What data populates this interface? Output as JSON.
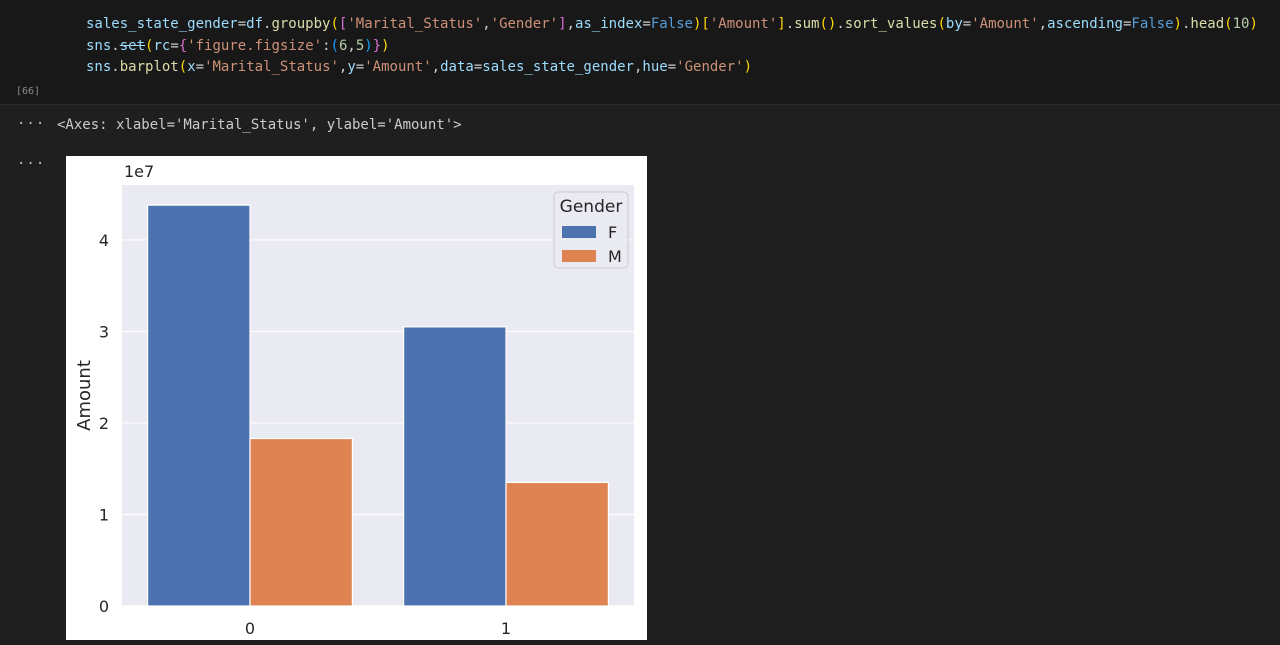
{
  "cell": {
    "execution_count": "[66]",
    "code_lines": [
      "sales_state_gender=df.groupby(['Marital_Status','Gender'],as_index=False)['Amount'].sum().sort_values(by='Amount',ascending=False).head(10)",
      "sns.set(rc={'figure.figsize':(6,5)})",
      "sns.barplot(x='Marital_Status',y='Amount',data=sales_state_gender,hue='Gender')"
    ]
  },
  "output": {
    "dots": "···",
    "text": "<Axes: xlabel='Marital_Status', ylabel='Amount'>"
  },
  "chart_data": {
    "type": "bar",
    "categories": [
      "0",
      "1"
    ],
    "series": [
      {
        "name": "F",
        "values": [
          43800000,
          30500000
        ]
      },
      {
        "name": "M",
        "values": [
          18300000,
          13500000
        ]
      }
    ],
    "ylabel": "Amount",
    "xlabel": "",
    "ylim": [
      0,
      46000000
    ],
    "yticks": [
      "0",
      "1",
      "2",
      "3",
      "4"
    ],
    "offset_label": "1e7",
    "legend": {
      "title": "Gender",
      "placement": "top-right"
    },
    "colors": {
      "F": "#4c72b0",
      "M": "#dd8452",
      "axes_bg": "#eaeaf2",
      "grid": "#ffffff"
    },
    "grid": true
  }
}
